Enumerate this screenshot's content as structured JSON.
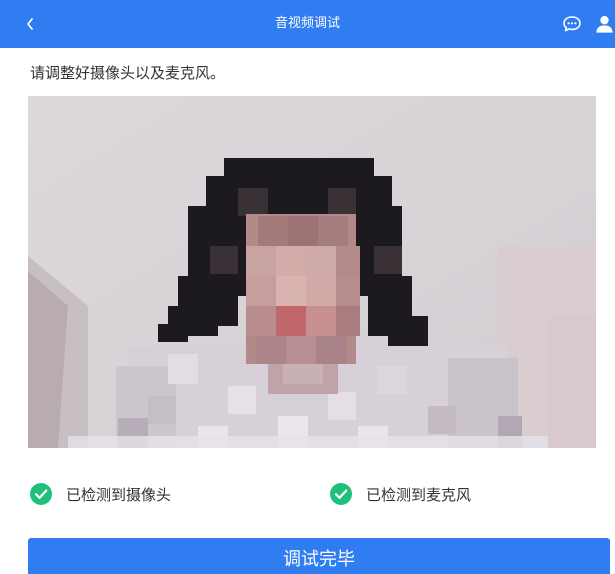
{
  "header": {
    "title": "音视频调试",
    "back_icon": "chevron-left-icon",
    "chat_icon": "chat-bubble-icon",
    "user_icon": "user-icon",
    "background_color": "#2f7df0"
  },
  "instruction": "请调整好摄像头以及麦克风。",
  "camera_preview": {
    "icon": "camera-feed-image",
    "content": "pixelated webcam feed"
  },
  "checks": [
    {
      "label": "已检测到摄像头",
      "icon": "check-circle-icon",
      "color": "#1ec07a"
    },
    {
      "label": "已检测到麦克风",
      "icon": "check-circle-icon",
      "color": "#1ec07a"
    }
  ],
  "finish_button": {
    "label": "调试完毕",
    "color": "#2f7df0"
  }
}
